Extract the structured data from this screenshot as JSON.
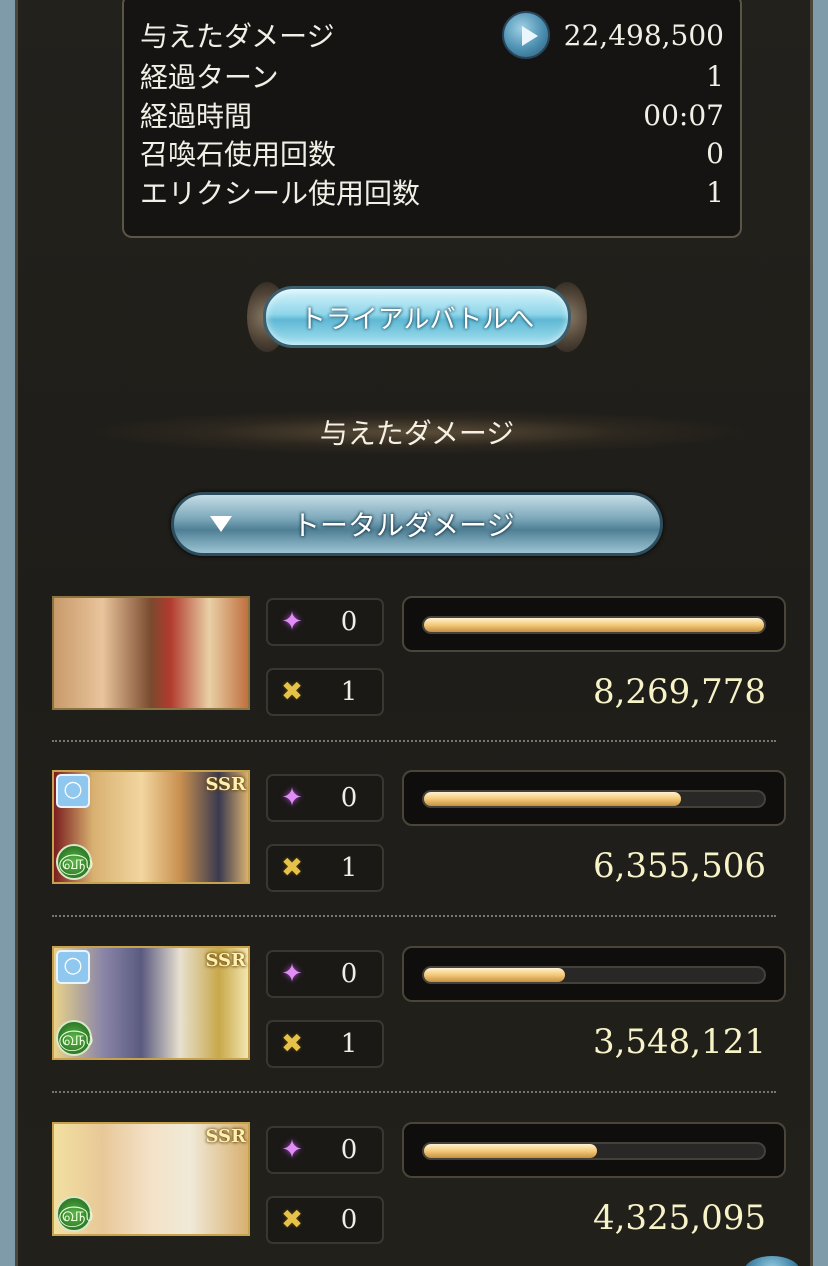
{
  "summary": {
    "rows": [
      {
        "label": "与えたダメージ",
        "value": "22,498,500"
      },
      {
        "label": "経過ターン",
        "value": "1"
      },
      {
        "label": "経過時間",
        "value": "00:07"
      },
      {
        "label": "召喚石使用回数",
        "value": "0"
      },
      {
        "label": "エリクシール使用回数",
        "value": "1"
      }
    ]
  },
  "trial_button": {
    "label": "トライアルバトルへ"
  },
  "section_title": "与えたダメージ",
  "dropdown": {
    "selected": "トータルダメージ"
  },
  "characters": [
    {
      "burst_count": "0",
      "chain_count": "1",
      "damage": "8,269,778",
      "bar_fraction": 1.0,
      "rarity": "",
      "has_ring": false,
      "element": ""
    },
    {
      "burst_count": "0",
      "chain_count": "1",
      "damage": "6,355,506",
      "bar_fraction": 0.755,
      "rarity": "SSR",
      "has_ring": true,
      "element": "wind"
    },
    {
      "burst_count": "0",
      "chain_count": "1",
      "damage": "3,548,121",
      "bar_fraction": 0.415,
      "rarity": "SSR",
      "has_ring": true,
      "element": "wind"
    },
    {
      "burst_count": "0",
      "chain_count": "0",
      "damage": "4,325,095",
      "bar_fraction": 0.51,
      "rarity": "SSR",
      "has_ring": false,
      "element": "wind"
    }
  ],
  "colors": {
    "bar_fill": "#f3c97a",
    "damage_text": "#f7f3c8",
    "panel_bg": "#151412"
  }
}
